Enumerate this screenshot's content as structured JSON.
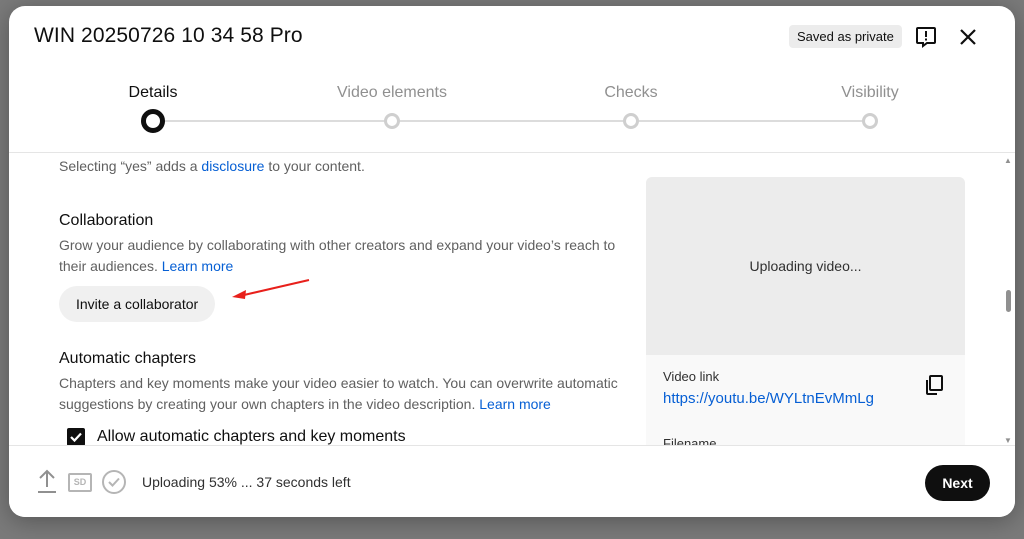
{
  "dialog": {
    "title": "WIN 20250726 10 34 58 Pro",
    "saved_badge": "Saved as private"
  },
  "stepper": {
    "steps": [
      {
        "label": "Details",
        "active": true
      },
      {
        "label": "Video elements",
        "active": false
      },
      {
        "label": "Checks",
        "active": false
      },
      {
        "label": "Visibility",
        "active": false
      }
    ]
  },
  "content": {
    "disclosure_prefix": "Selecting “yes” adds a ",
    "disclosure_link": "disclosure",
    "disclosure_suffix": " to your content.",
    "collaboration": {
      "title": "Collaboration",
      "description": "Grow your audience by collaborating with other creators and expand your video’s reach to their audiences.",
      "learn_more": "Learn more",
      "invite_button": "Invite a collaborator"
    },
    "chapters": {
      "title": "Automatic chapters",
      "description": "Chapters and key moments make your video easier to watch. You can overwrite automatic suggestions by creating your own chapters in the video description.",
      "learn_more": "Learn more",
      "checkbox_label": "Allow automatic chapters and key moments",
      "checked": true
    }
  },
  "preview": {
    "status": "Uploading video...",
    "video_link_label": "Video link",
    "video_link": "https://youtu.be/WYLtnEvMmLg",
    "filename_label": "Filename"
  },
  "footer": {
    "sd_label": "SD",
    "status": "Uploading 53% ... 37 seconds left",
    "next_button": "Next"
  },
  "colors": {
    "link": "#065fd4",
    "primary": "#0f0f0f",
    "annotation_arrow": "#e8201b"
  }
}
